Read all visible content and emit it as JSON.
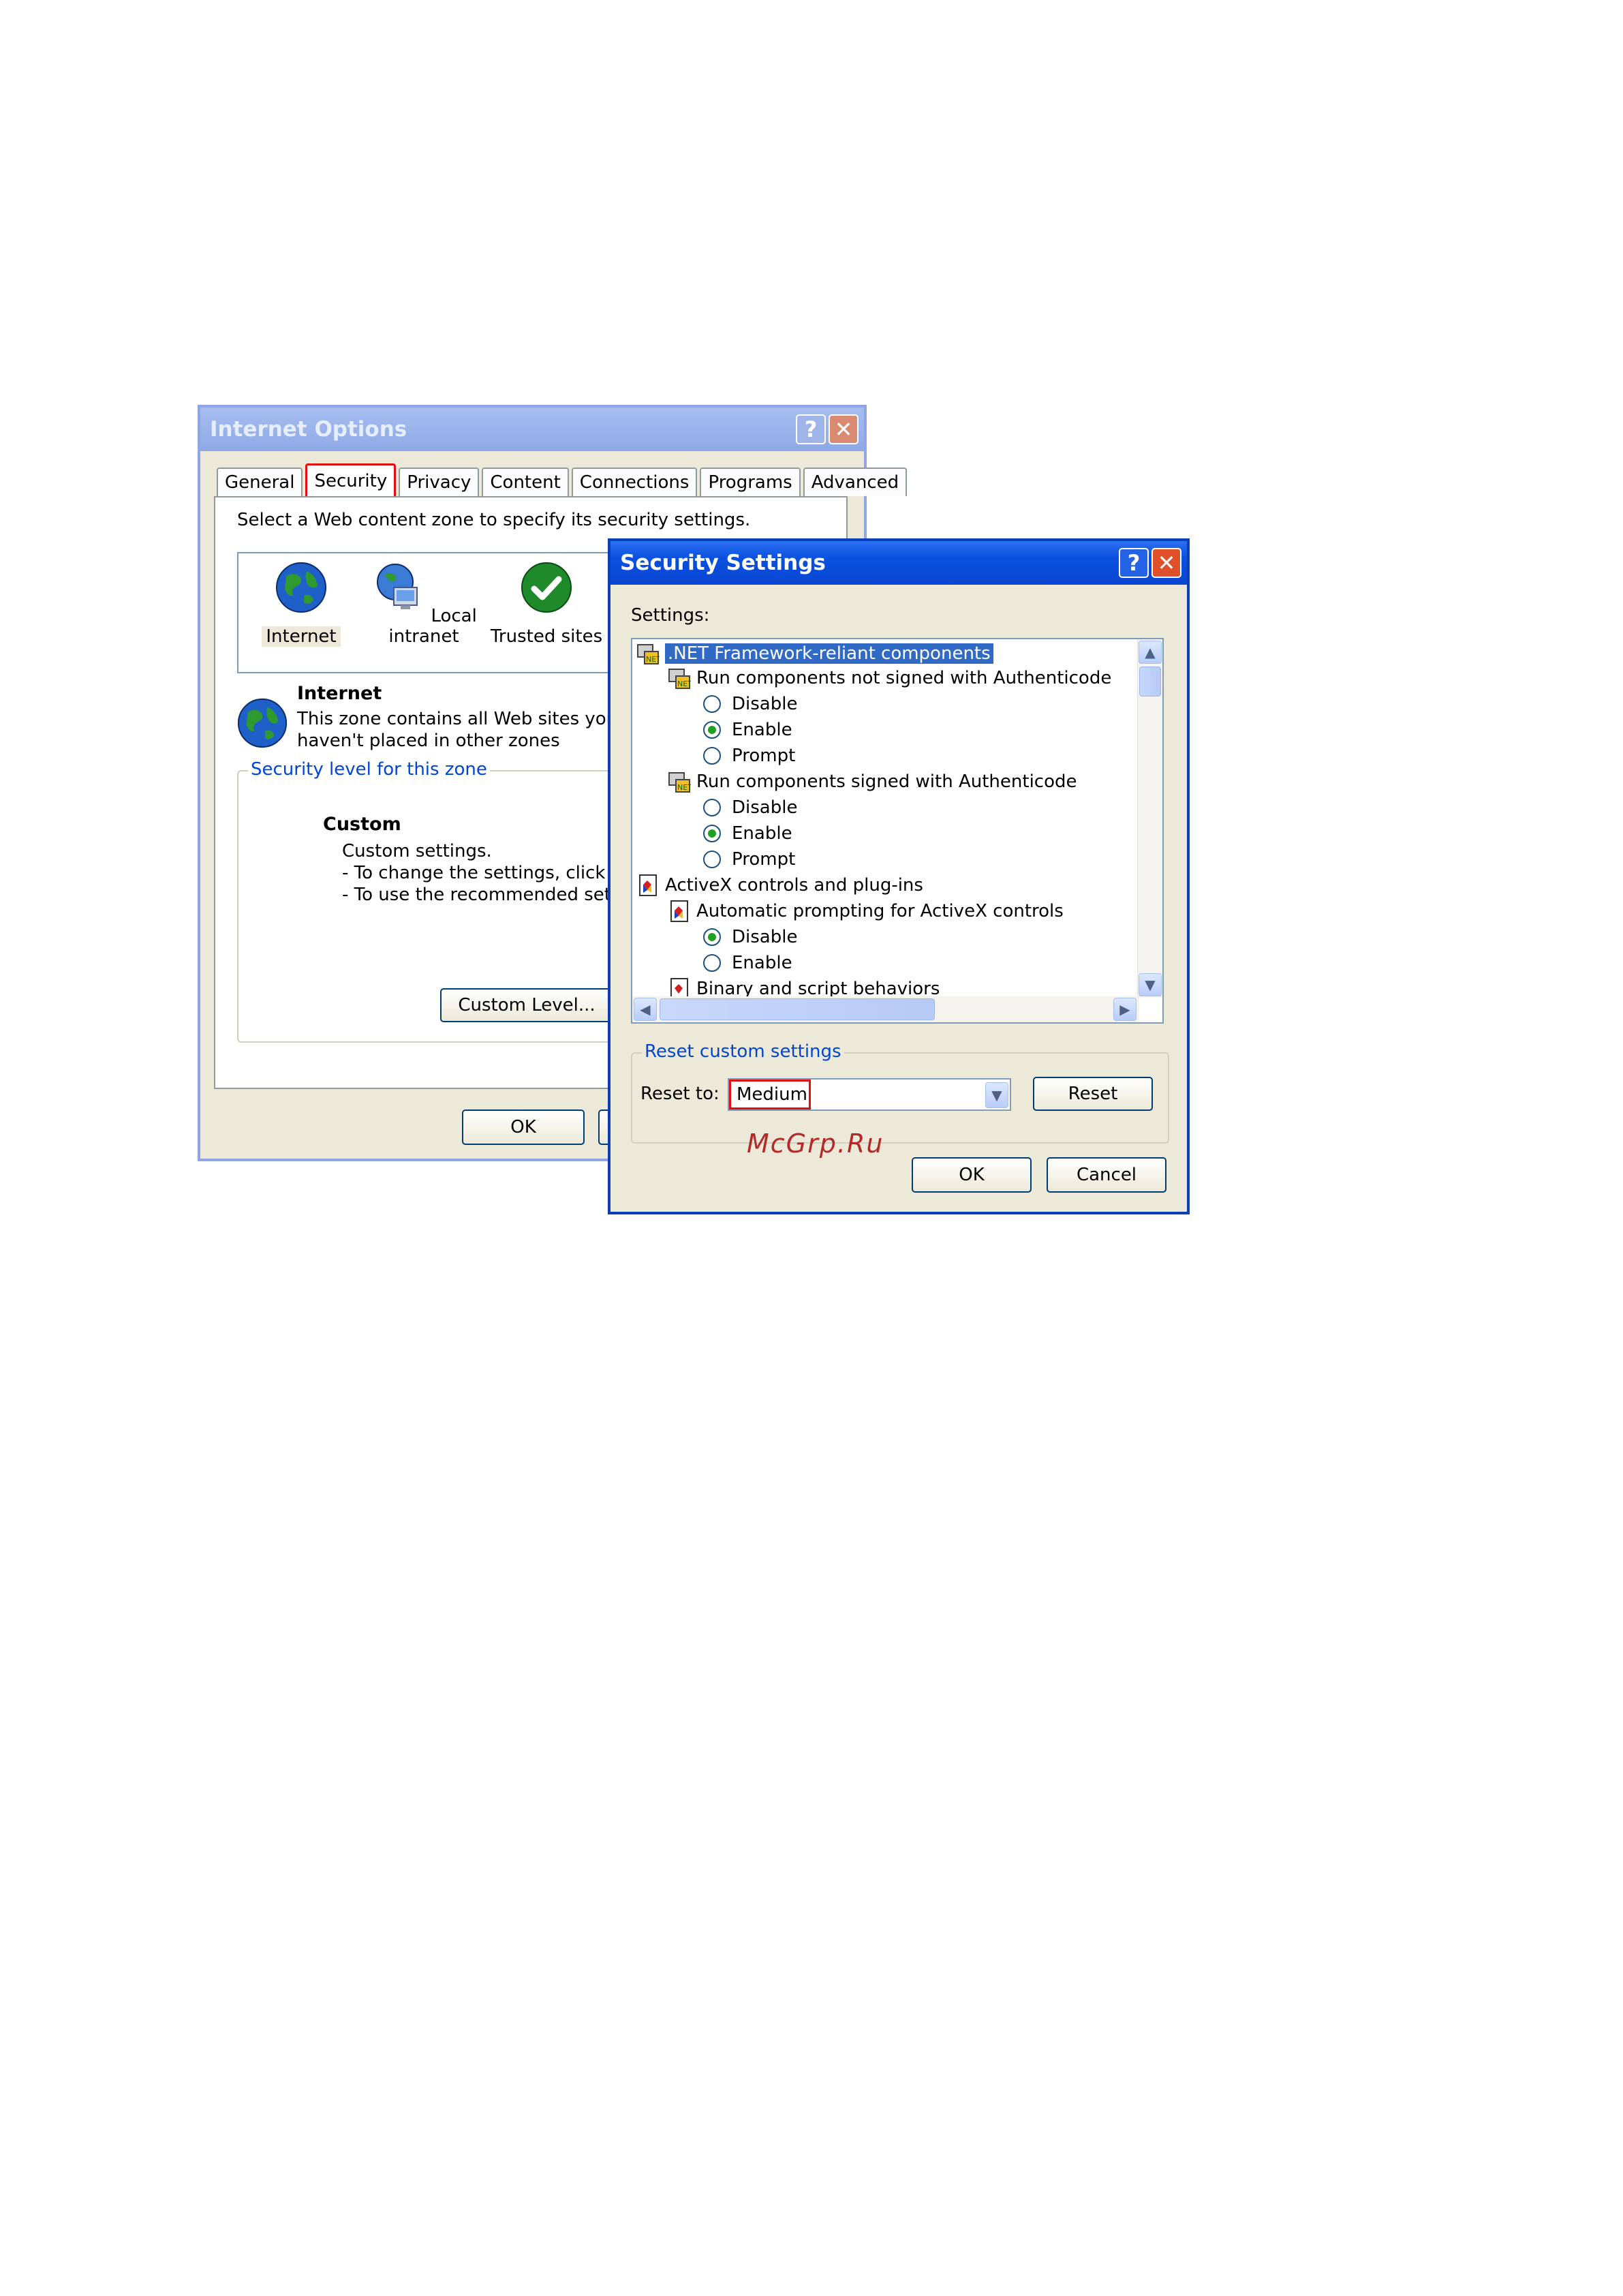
{
  "internet_options": {
    "title": "Internet Options",
    "help": "?",
    "close": "✕",
    "tabs": [
      "General",
      "Security",
      "Privacy",
      "Content",
      "Connections",
      "Programs",
      "Advanced"
    ],
    "zone_prompt": "Select a Web content zone to specify its security settings.",
    "zones": [
      "Internet",
      "Local intranet",
      "Trusted sites"
    ],
    "zone_title": "Internet",
    "zone_desc_1": "This zone contains all Web sites you",
    "zone_desc_2": "haven't placed in other zones",
    "level_legend": "Security level for this zone",
    "level_name": "Custom",
    "level_line_1": "Custom settings.",
    "level_line_2": "- To change the settings, click Cus",
    "level_line_3": "- To use the recommended setting",
    "custom_level_button": "Custom Level...",
    "ok_button": "OK"
  },
  "security_settings": {
    "title": "Security Settings",
    "help": "?",
    "close": "✕",
    "settings_label": "Settings:",
    "items": [
      ".NET Framework-reliant components",
      "Run components not signed with Authenticode",
      "Disable",
      "Enable",
      "Prompt",
      "Run components signed with Authenticode",
      "Disable",
      "Enable",
      "Prompt",
      "ActiveX controls and plug-ins",
      "Automatic prompting for ActiveX controls",
      "Disable",
      "Enable",
      "Binary and script behaviors"
    ],
    "reset_legend": "Reset custom settings",
    "reset_to_label": "Reset to:",
    "reset_value": "Medium",
    "reset_button": "Reset",
    "ok_button": "OK",
    "cancel_button": "Cancel"
  },
  "watermark": "McGrp.Ru"
}
